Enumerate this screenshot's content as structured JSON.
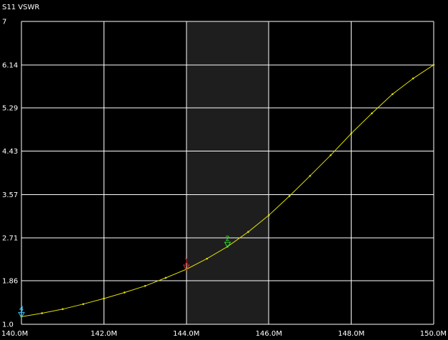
{
  "chart_data": {
    "type": "line",
    "title": "S11 VSWR",
    "xlim": [
      140.0,
      150.0
    ],
    "ylim": [
      1.0,
      7.0
    ],
    "x_tick_values": [
      140.0,
      142.0,
      144.0,
      146.0,
      148.0,
      150.0
    ],
    "x_tick_labels": [
      "140.0M",
      "142.0M",
      "144.0M",
      "146.0M",
      "148.0M",
      "150.0M"
    ],
    "y_tick_values": [
      1.0,
      1.86,
      2.71,
      3.57,
      4.43,
      5.29,
      6.14,
      7.0
    ],
    "y_tick_labels": [
      "1.0",
      "1.86",
      "2.71",
      "3.57",
      "4.43",
      "5.29",
      "6.14",
      "7"
    ],
    "grid": true,
    "highlight_band": [
      144.0,
      146.0
    ],
    "series": [
      {
        "color": "#e0e000",
        "x": [
          140.0,
          140.5,
          141.0,
          141.5,
          142.0,
          142.5,
          143.0,
          143.5,
          144.0,
          144.5,
          145.0,
          145.5,
          146.0,
          146.5,
          147.0,
          147.5,
          148.0,
          148.5,
          149.0,
          149.5,
          150.0
        ],
        "y": [
          1.15,
          1.22,
          1.3,
          1.4,
          1.51,
          1.63,
          1.76,
          1.92,
          2.09,
          2.3,
          2.54,
          2.83,
          3.16,
          3.54,
          3.94,
          4.35,
          4.78,
          5.18,
          5.56,
          5.87,
          6.14
        ]
      }
    ],
    "markers": [
      {
        "label": "4",
        "x": 140.0,
        "y": 1.15,
        "color": "#33c8ff"
      },
      {
        "label": "1",
        "x": 144.0,
        "y": 2.09,
        "color": "#e02020"
      },
      {
        "label": "2",
        "x": 145.0,
        "y": 2.54,
        "color": "#33dd33"
      }
    ]
  },
  "colors": {
    "background": "#000000",
    "grid": "#ffffff",
    "band": "#1e1e1e",
    "text": "#ffffff"
  }
}
